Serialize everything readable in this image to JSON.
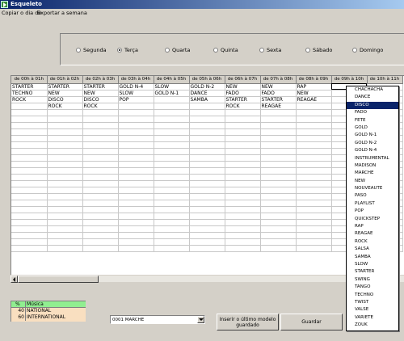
{
  "window": {
    "title": "Esqueleto"
  },
  "menu": {
    "items": [
      "Copiar o dia de",
      "Exportar a semana"
    ]
  },
  "days": [
    {
      "label": "Segunda",
      "selected": false
    },
    {
      "label": "Terça",
      "selected": true
    },
    {
      "label": "Quarta",
      "selected": false
    },
    {
      "label": "Quinta",
      "selected": false
    },
    {
      "label": "Sexta",
      "selected": false
    },
    {
      "label": "Sábado",
      "selected": false
    },
    {
      "label": "Domingo",
      "selected": false
    }
  ],
  "grid": {
    "headers": [
      "de 00h à 01h",
      "de 01h à 02h",
      "de 02h à 03h",
      "de 03h à 04h",
      "de 04h à 05h",
      "de 05h à 06h",
      "de 06h à 07h",
      "de 07h à 08h",
      "de 08h à 09h",
      "de 09h à 10h",
      "de 10h à 11h"
    ],
    "rows": [
      [
        "STARTER",
        "STARTER",
        "STARTER",
        "GOLD N-4",
        "SLOW",
        "GOLD N-2",
        "NEW",
        "NEW",
        "RAP",
        "",
        ""
      ],
      [
        "TECHNO",
        "NEW",
        "NEW",
        "SLOW",
        "GOLD N-1",
        "DANCE",
        "FADO",
        "FADO",
        "NEW",
        "",
        ""
      ],
      [
        "ROCK",
        "DISCO",
        "DISCO",
        "POP",
        "",
        "SAMBA",
        "STARTER",
        "STARTER",
        "REAGAE",
        "",
        ""
      ],
      [
        "",
        "ROCK",
        "ROCK",
        "",
        "",
        "",
        "ROCK",
        "REAGAE",
        "",
        "",
        ""
      ]
    ],
    "empty_row_count": 22
  },
  "genre_options": [
    "CHACHACHA",
    "DANCE",
    "DISCO",
    "FADO",
    "FETE",
    "GOLD",
    "GOLD N-1",
    "GOLD N-2",
    "GOLD N-4",
    "INSTRUMENTAL",
    "MADISON",
    "MARCHE",
    "NEW",
    "NOUVEAUTE",
    "PASO",
    "PLAYLIST",
    "POP",
    "QUICKSTEP",
    "RAP",
    "REAGAE",
    "ROCK",
    "SALSA",
    "SAMBA",
    "SLOW",
    "STARTER",
    "SWING",
    "TANGO",
    "TECHNO",
    "TWIST",
    "VALSE",
    "VARIETE",
    "ZOUK"
  ],
  "genre_selected": "DISCO",
  "music_table": {
    "headers": [
      "%",
      "Música"
    ],
    "rows": [
      {
        "pct": "40",
        "name": "NATIONAL"
      },
      {
        "pct": "60",
        "name": "INTERNATIONAL"
      }
    ]
  },
  "combo": {
    "value": "0001 MARCHE"
  },
  "buttons": {
    "insert_line1": "Inserir o último modelo",
    "insert_line2": "guardado",
    "save": "Guardar"
  },
  "colors": {
    "titlebar": "#0a246a",
    "highlight": "#0a246a",
    "music_header": "#90ee90",
    "music_body": "#f9dfc0"
  }
}
